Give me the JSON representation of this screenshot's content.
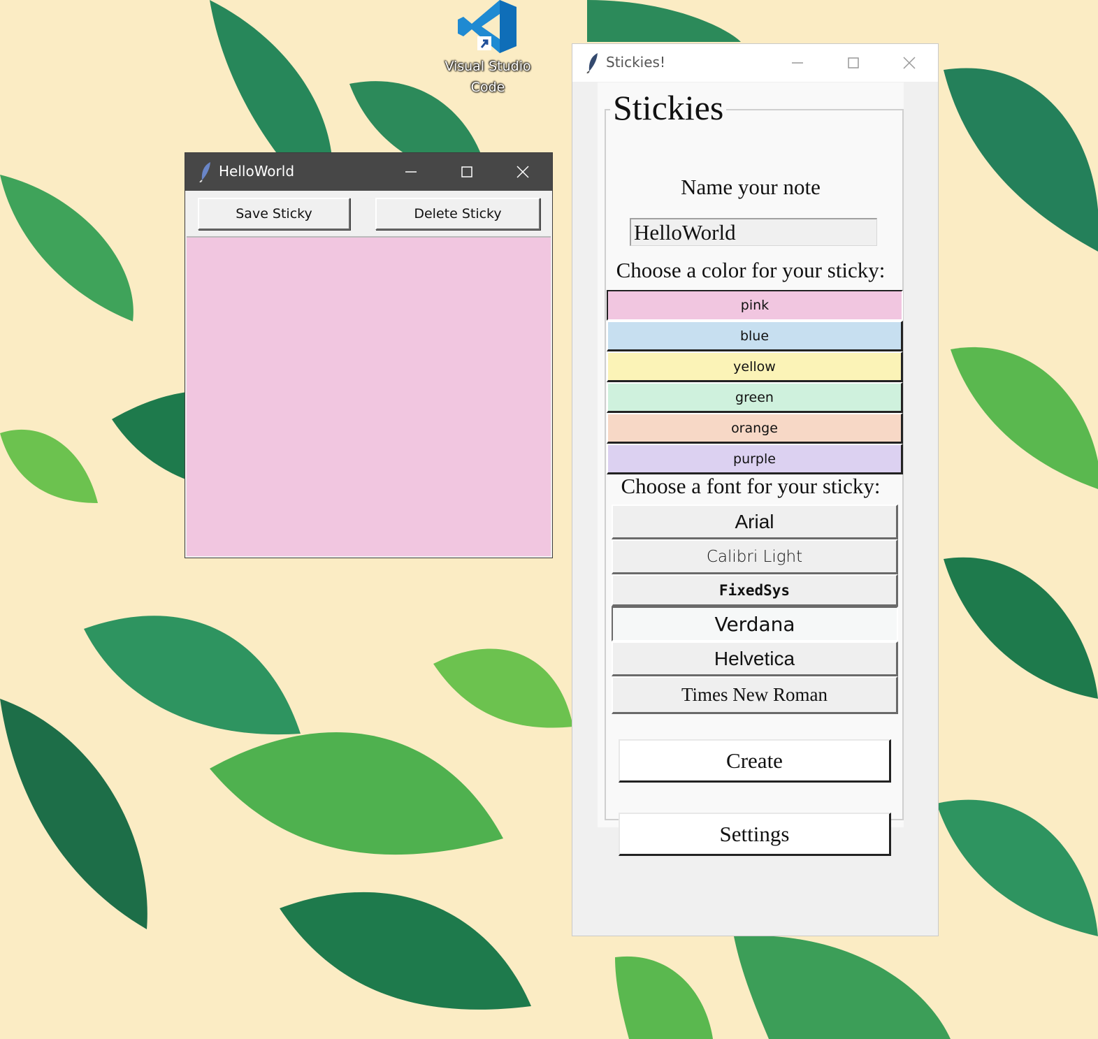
{
  "desktop": {
    "icon_label_line1": "Visual Studio",
    "icon_label_line2": "Code",
    "background_color": "#fbecc4",
    "leaf_color_dark": "#1e7a4c",
    "leaf_color_light": "#5fbf4a"
  },
  "hello_window": {
    "title": "HelloWorld",
    "save_label": "Save Sticky",
    "delete_label": "Delete Sticky",
    "note_color": "#f1c6e0"
  },
  "stickies_window": {
    "title": "Stickies!",
    "frame_title": "Stickies",
    "name_label": "Name your note",
    "name_value": "HelloWorld",
    "color_label": "Choose a color for your sticky:",
    "colors": [
      {
        "label": "pink",
        "hex": "#f1c6e0"
      },
      {
        "label": "blue",
        "hex": "#c7dff0"
      },
      {
        "label": "yellow",
        "hex": "#fbf3b7"
      },
      {
        "label": "green",
        "hex": "#cff1dd"
      },
      {
        "label": "orange",
        "hex": "#f7d8c6"
      },
      {
        "label": "purple",
        "hex": "#dcd1f1"
      }
    ],
    "font_label": "Choose a font for your sticky:",
    "fonts": [
      {
        "label": "Arial"
      },
      {
        "label": "Calibri Light"
      },
      {
        "label": "FixedSys"
      },
      {
        "label": "Verdana"
      },
      {
        "label": "Helvetica"
      },
      {
        "label": "Times New Roman"
      }
    ],
    "create_label": "Create",
    "settings_label": "Settings"
  }
}
